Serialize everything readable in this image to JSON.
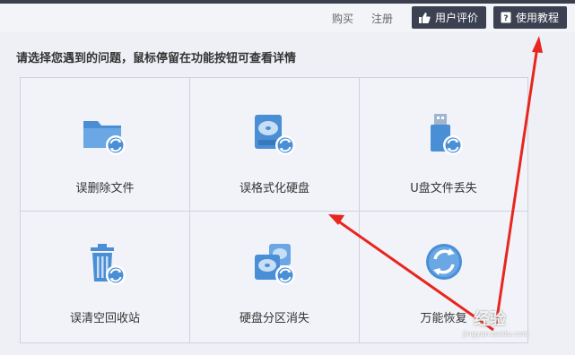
{
  "header": {
    "buy_label": "购买",
    "register_label": "注册",
    "review_label": "用户评价",
    "tutorial_label": "使用教程"
  },
  "prompt": "请选择您遇到的问题，鼠标停留在功能按钮可查看详情",
  "options": [
    {
      "label": "误删除文件",
      "icon": "folder-recover-icon"
    },
    {
      "label": "误格式化硬盘",
      "icon": "harddisk-recover-icon"
    },
    {
      "label": "U盘文件丢失",
      "icon": "usb-recover-icon"
    },
    {
      "label": "误清空回收站",
      "icon": "recycle-bin-recover-icon"
    },
    {
      "label": "硬盘分区消失",
      "icon": "partition-recover-icon"
    },
    {
      "label": "万能恢复",
      "icon": "universal-recover-icon"
    }
  ],
  "watermark": {
    "text": "经验",
    "sub": "jingyan.baidu.com"
  },
  "colors": {
    "icon_blue": "#4a8fd6",
    "button_bg": "#3b4150",
    "arrow_red": "#e8261f"
  }
}
